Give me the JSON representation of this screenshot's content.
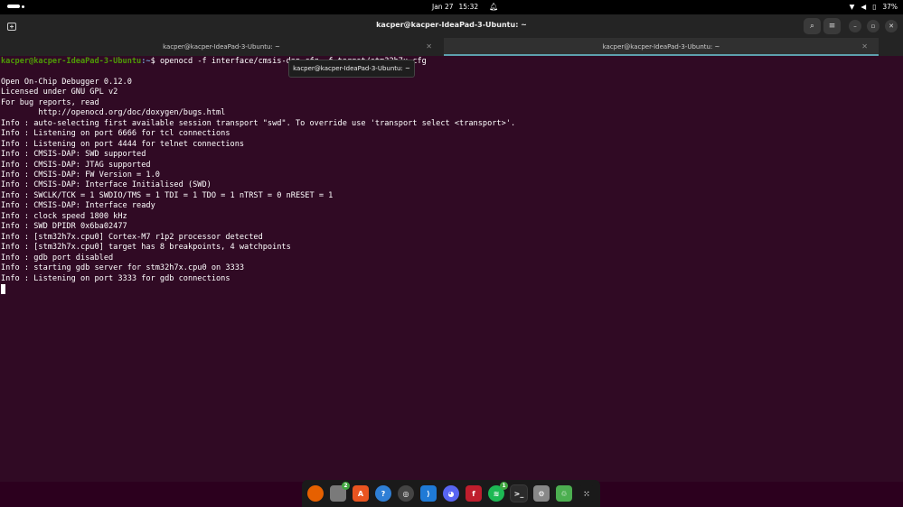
{
  "topbar": {
    "date": "Jan 27",
    "time": "15:32",
    "battery": "37%"
  },
  "window": {
    "title": "kacper@kacper-IdeaPad-3-Ubuntu: ~"
  },
  "tabs": [
    {
      "label": "kacper@kacper-IdeaPad-3-Ubuntu: ~"
    },
    {
      "label": "kacper@kacper-IdeaPad-3-Ubuntu: ~"
    }
  ],
  "tooltip": "kacper@kacper-IdeaPad-3-Ubuntu: ~",
  "terminal": {
    "prompt_user": "kacper@kacper-IdeaPad-3-Ubuntu",
    "prompt_path": ":~",
    "prompt_symbol": "$ ",
    "command": "openocd -f interface/cmsis-dap.cfg -f target/stm32h7x.cfg",
    "output": [
      "Open On-Chip Debugger 0.12.0",
      "Licensed under GNU GPL v2",
      "For bug reports, read",
      "        http://openocd.org/doc/doxygen/bugs.html",
      "Info : auto-selecting first available session transport \"swd\". To override use 'transport select <transport>'.",
      "Info : Listening on port 6666 for tcl connections",
      "Info : Listening on port 4444 for telnet connections",
      "Info : CMSIS-DAP: SWD supported",
      "Info : CMSIS-DAP: JTAG supported",
      "Info : CMSIS-DAP: FW Version = 1.0",
      "Info : CMSIS-DAP: Interface Initialised (SWD)",
      "Info : SWCLK/TCK = 1 SWDIO/TMS = 1 TDI = 1 TDO = 1 nTRST = 0 nRESET = 1",
      "Info : CMSIS-DAP: Interface ready",
      "Info : clock speed 1800 kHz",
      "Info : SWD DPIDR 0x6ba02477",
      "Info : [stm32h7x.cpu0] Cortex-M7 r1p2 processor detected",
      "Info : [stm32h7x.cpu0] target has 8 breakpoints, 4 watchpoints",
      "Info : gdb port disabled",
      "Info : starting gdb server for stm32h7x.cpu0 on 3333",
      "Info : Listening on port 3333 for gdb connections"
    ]
  },
  "dock": {
    "apps": [
      {
        "name": "firefox-icon",
        "glyph": "",
        "color": "#e66000"
      },
      {
        "name": "files-icon",
        "glyph": "",
        "color": "#7a7a7a",
        "badge": "2"
      },
      {
        "name": "app-center-icon",
        "glyph": "A",
        "color": "#e95420"
      },
      {
        "name": "help-icon",
        "glyph": "?",
        "color": "#2f7fd6"
      },
      {
        "name": "obs-icon",
        "glyph": "◎",
        "color": "#444"
      },
      {
        "name": "vscode-icon",
        "glyph": "⟩",
        "color": "#1f7ad6"
      },
      {
        "name": "discord-icon",
        "glyph": "◕",
        "color": "#5865f2"
      },
      {
        "name": "filezilla-icon",
        "glyph": "f",
        "color": "#bf1e2d"
      },
      {
        "name": "spotify-icon",
        "glyph": "≋",
        "color": "#1db954",
        "badge": "1"
      },
      {
        "name": "terminal-icon",
        "glyph": ">_",
        "color": "#2b2b2b",
        "active": true
      },
      {
        "name": "settings-icon",
        "glyph": "⚙",
        "color": "#888"
      },
      {
        "name": "trash-icon",
        "glyph": "♲",
        "color": "#4caf50"
      },
      {
        "name": "show-apps-icon",
        "glyph": "⁙",
        "color": "#1a1a1a"
      }
    ]
  }
}
